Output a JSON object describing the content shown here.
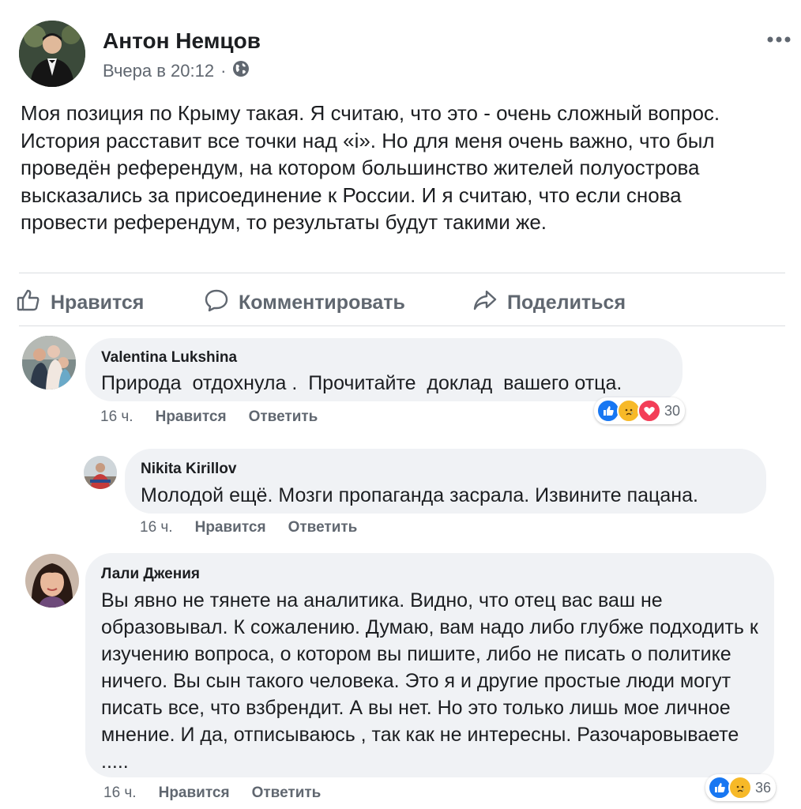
{
  "post": {
    "author": "Антон Немцов",
    "time": "Вчера в 20:12",
    "separator": "·",
    "text": "Моя позиция по Крыму такая. Я считаю, что это - очень сложный вопрос. История расставит все точки над «і». Но для меня очень важно, что был проведён референдум, на котором большинство жителей полуострова высказались за присоединение к России. И я считаю, что если снова провести референдум, то результаты будут такими же."
  },
  "actions": {
    "like": "Нравится",
    "comment": "Комментировать",
    "share": "Поделиться"
  },
  "comments": [
    {
      "name": "Valentina Lukshina",
      "text": "Природа  отдохнула .  Прочитайте  доклад  вашего отца.",
      "time": "16 ч.",
      "like": "Нравится",
      "reply": "Ответить",
      "reaction_count": "30",
      "reactions": [
        "like-icon",
        "sad-icon",
        "love-icon"
      ]
    },
    {
      "name": "Nikita Kirillov",
      "text": "Молодой ещё. Мозги пропаганда засрала. Извините пацана.",
      "time": "16 ч.",
      "like": "Нравится",
      "reply": "Ответить"
    },
    {
      "name": "Лали Джения",
      "text": "Вы явно не тянете на аналитика. Видно, что отец вас ваш не образовывал. К сожалению. Думаю, вам надо либо глубже подходить к изучению вопроса, о котором вы пишите, либо не писать о политике ничего. Вы сын такого человека. Это я и другие простые люди могут писать все, что взбрендит. А вы нет. Но это только лишь мое личное мнение. И да, отписываюсь , так как не интересны. Разочаровываете .....",
      "time": "16 ч.",
      "like": "Нравится",
      "reply": "Ответить",
      "reaction_count": "36",
      "reactions": [
        "like-icon",
        "sad-icon"
      ]
    }
  ],
  "colors": {
    "like_blue": "#1877f2",
    "love_red": "#f33e58",
    "sad_yellow": "#f7b928",
    "secondary_text": "#606770",
    "bubble_bg": "#f0f2f5"
  }
}
